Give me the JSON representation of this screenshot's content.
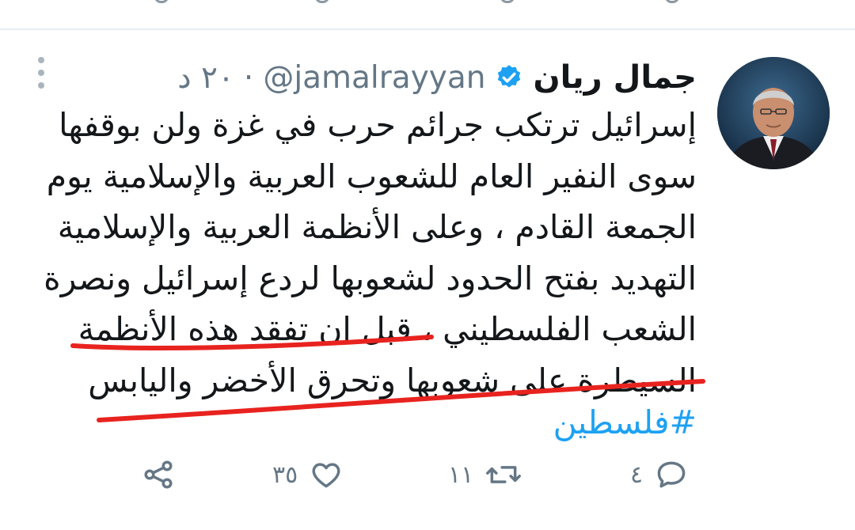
{
  "tweet": {
    "author_name": "جمال ريان",
    "handle": "@jamalrayyan",
    "separator": "·",
    "time": "٢٠ د",
    "verified": true,
    "text_lines": [
      "إسرائيل ترتكب جرائم حرب في غزة ولن بوقفها",
      "سوى النفير العام للشعوب العربية والإسلامية يوم",
      "الجمعة القادم ، وعلى الأنظمة العربية والإسلامية",
      "التهديد بفتح الحدود لشعوبها لردع إسرائيل ونصرة",
      "الشعب الفلسطيني ، قبل ان تفقد هذه الأنظمة",
      "السيطرة على شعوبها  وتحرق الأخضر واليابس"
    ],
    "hashtag": "#فلسطين"
  },
  "actions": {
    "reply_count": "٤",
    "retweet_count": "١١",
    "like_count": "٣٥"
  },
  "icons": {
    "more": "vertical-dots-icon",
    "verified": "verified-badge-icon",
    "reply": "comment-icon",
    "retweet": "retweet-icon",
    "like": "heart-icon",
    "share": "share-icon"
  },
  "colors": {
    "accent": "#1da1f2",
    "text": "#14171a",
    "muted": "#657786",
    "annotation": "#e8231f"
  }
}
